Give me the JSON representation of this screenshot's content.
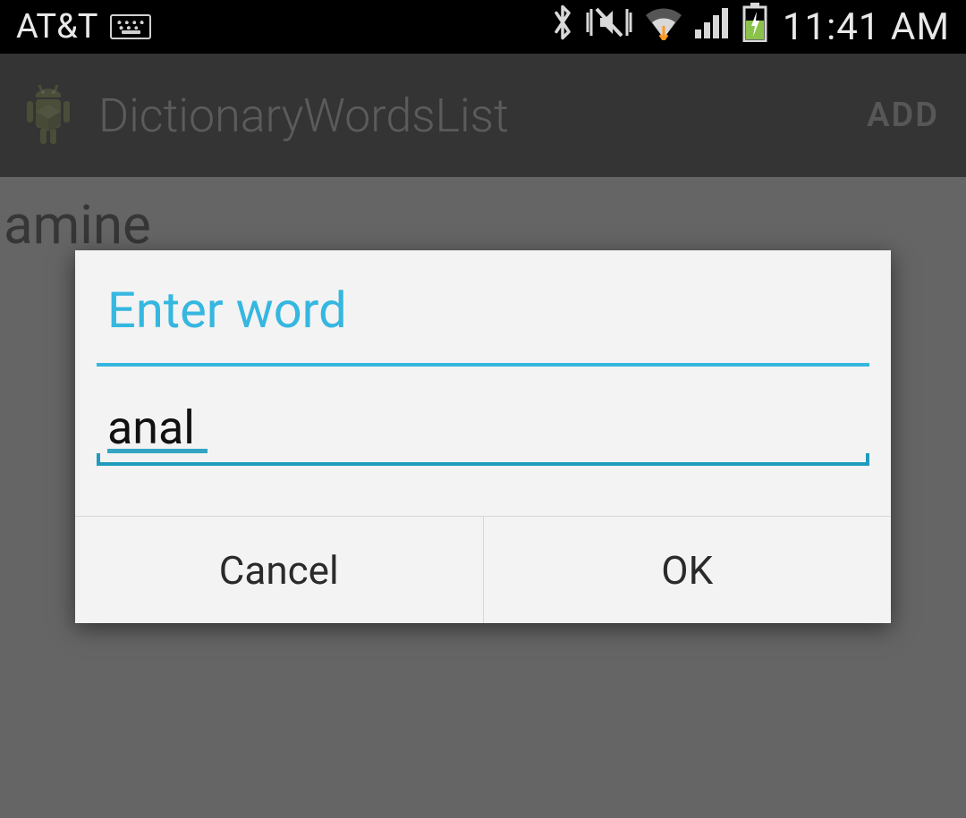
{
  "status_bar": {
    "carrier": "AT&T",
    "time": "11:41 AM",
    "icons": {
      "keyboard": "keyboard-icon",
      "bluetooth": "bluetooth-icon",
      "vibrate": "vibrate-silent-icon",
      "wifi": "wifi-icon",
      "signal": "cell-signal-icon",
      "battery": "battery-charging-icon"
    }
  },
  "action_bar": {
    "title": "DictionaryWordsList",
    "add_label": "ADD"
  },
  "list": {
    "items": [
      "amine"
    ]
  },
  "dialog": {
    "title": "Enter word",
    "input_value": "anal",
    "cancel_label": "Cancel",
    "ok_label": "OK"
  },
  "colors": {
    "accent": "#35b7e0",
    "accent_dark": "#1f9bbd",
    "battery_green": "#8bc34a"
  }
}
